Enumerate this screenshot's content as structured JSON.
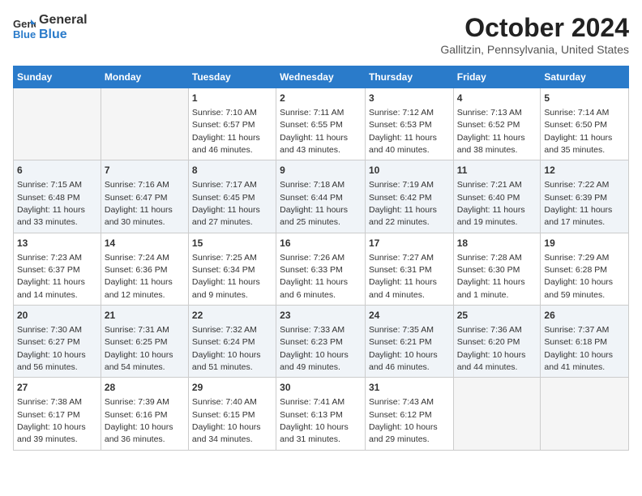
{
  "header": {
    "logo_line1": "General",
    "logo_line2": "Blue",
    "month": "October 2024",
    "location": "Gallitzin, Pennsylvania, United States"
  },
  "weekdays": [
    "Sunday",
    "Monday",
    "Tuesday",
    "Wednesday",
    "Thursday",
    "Friday",
    "Saturday"
  ],
  "weeks": [
    [
      {
        "day": "",
        "info": ""
      },
      {
        "day": "",
        "info": ""
      },
      {
        "day": "1",
        "info": "Sunrise: 7:10 AM\nSunset: 6:57 PM\nDaylight: 11 hours and 46 minutes."
      },
      {
        "day": "2",
        "info": "Sunrise: 7:11 AM\nSunset: 6:55 PM\nDaylight: 11 hours and 43 minutes."
      },
      {
        "day": "3",
        "info": "Sunrise: 7:12 AM\nSunset: 6:53 PM\nDaylight: 11 hours and 40 minutes."
      },
      {
        "day": "4",
        "info": "Sunrise: 7:13 AM\nSunset: 6:52 PM\nDaylight: 11 hours and 38 minutes."
      },
      {
        "day": "5",
        "info": "Sunrise: 7:14 AM\nSunset: 6:50 PM\nDaylight: 11 hours and 35 minutes."
      }
    ],
    [
      {
        "day": "6",
        "info": "Sunrise: 7:15 AM\nSunset: 6:48 PM\nDaylight: 11 hours and 33 minutes."
      },
      {
        "day": "7",
        "info": "Sunrise: 7:16 AM\nSunset: 6:47 PM\nDaylight: 11 hours and 30 minutes."
      },
      {
        "day": "8",
        "info": "Sunrise: 7:17 AM\nSunset: 6:45 PM\nDaylight: 11 hours and 27 minutes."
      },
      {
        "day": "9",
        "info": "Sunrise: 7:18 AM\nSunset: 6:44 PM\nDaylight: 11 hours and 25 minutes."
      },
      {
        "day": "10",
        "info": "Sunrise: 7:19 AM\nSunset: 6:42 PM\nDaylight: 11 hours and 22 minutes."
      },
      {
        "day": "11",
        "info": "Sunrise: 7:21 AM\nSunset: 6:40 PM\nDaylight: 11 hours and 19 minutes."
      },
      {
        "day": "12",
        "info": "Sunrise: 7:22 AM\nSunset: 6:39 PM\nDaylight: 11 hours and 17 minutes."
      }
    ],
    [
      {
        "day": "13",
        "info": "Sunrise: 7:23 AM\nSunset: 6:37 PM\nDaylight: 11 hours and 14 minutes."
      },
      {
        "day": "14",
        "info": "Sunrise: 7:24 AM\nSunset: 6:36 PM\nDaylight: 11 hours and 12 minutes."
      },
      {
        "day": "15",
        "info": "Sunrise: 7:25 AM\nSunset: 6:34 PM\nDaylight: 11 hours and 9 minutes."
      },
      {
        "day": "16",
        "info": "Sunrise: 7:26 AM\nSunset: 6:33 PM\nDaylight: 11 hours and 6 minutes."
      },
      {
        "day": "17",
        "info": "Sunrise: 7:27 AM\nSunset: 6:31 PM\nDaylight: 11 hours and 4 minutes."
      },
      {
        "day": "18",
        "info": "Sunrise: 7:28 AM\nSunset: 6:30 PM\nDaylight: 11 hours and 1 minute."
      },
      {
        "day": "19",
        "info": "Sunrise: 7:29 AM\nSunset: 6:28 PM\nDaylight: 10 hours and 59 minutes."
      }
    ],
    [
      {
        "day": "20",
        "info": "Sunrise: 7:30 AM\nSunset: 6:27 PM\nDaylight: 10 hours and 56 minutes."
      },
      {
        "day": "21",
        "info": "Sunrise: 7:31 AM\nSunset: 6:25 PM\nDaylight: 10 hours and 54 minutes."
      },
      {
        "day": "22",
        "info": "Sunrise: 7:32 AM\nSunset: 6:24 PM\nDaylight: 10 hours and 51 minutes."
      },
      {
        "day": "23",
        "info": "Sunrise: 7:33 AM\nSunset: 6:23 PM\nDaylight: 10 hours and 49 minutes."
      },
      {
        "day": "24",
        "info": "Sunrise: 7:35 AM\nSunset: 6:21 PM\nDaylight: 10 hours and 46 minutes."
      },
      {
        "day": "25",
        "info": "Sunrise: 7:36 AM\nSunset: 6:20 PM\nDaylight: 10 hours and 44 minutes."
      },
      {
        "day": "26",
        "info": "Sunrise: 7:37 AM\nSunset: 6:18 PM\nDaylight: 10 hours and 41 minutes."
      }
    ],
    [
      {
        "day": "27",
        "info": "Sunrise: 7:38 AM\nSunset: 6:17 PM\nDaylight: 10 hours and 39 minutes."
      },
      {
        "day": "28",
        "info": "Sunrise: 7:39 AM\nSunset: 6:16 PM\nDaylight: 10 hours and 36 minutes."
      },
      {
        "day": "29",
        "info": "Sunrise: 7:40 AM\nSunset: 6:15 PM\nDaylight: 10 hours and 34 minutes."
      },
      {
        "day": "30",
        "info": "Sunrise: 7:41 AM\nSunset: 6:13 PM\nDaylight: 10 hours and 31 minutes."
      },
      {
        "day": "31",
        "info": "Sunrise: 7:43 AM\nSunset: 6:12 PM\nDaylight: 10 hours and 29 minutes."
      },
      {
        "day": "",
        "info": ""
      },
      {
        "day": "",
        "info": ""
      }
    ]
  ]
}
